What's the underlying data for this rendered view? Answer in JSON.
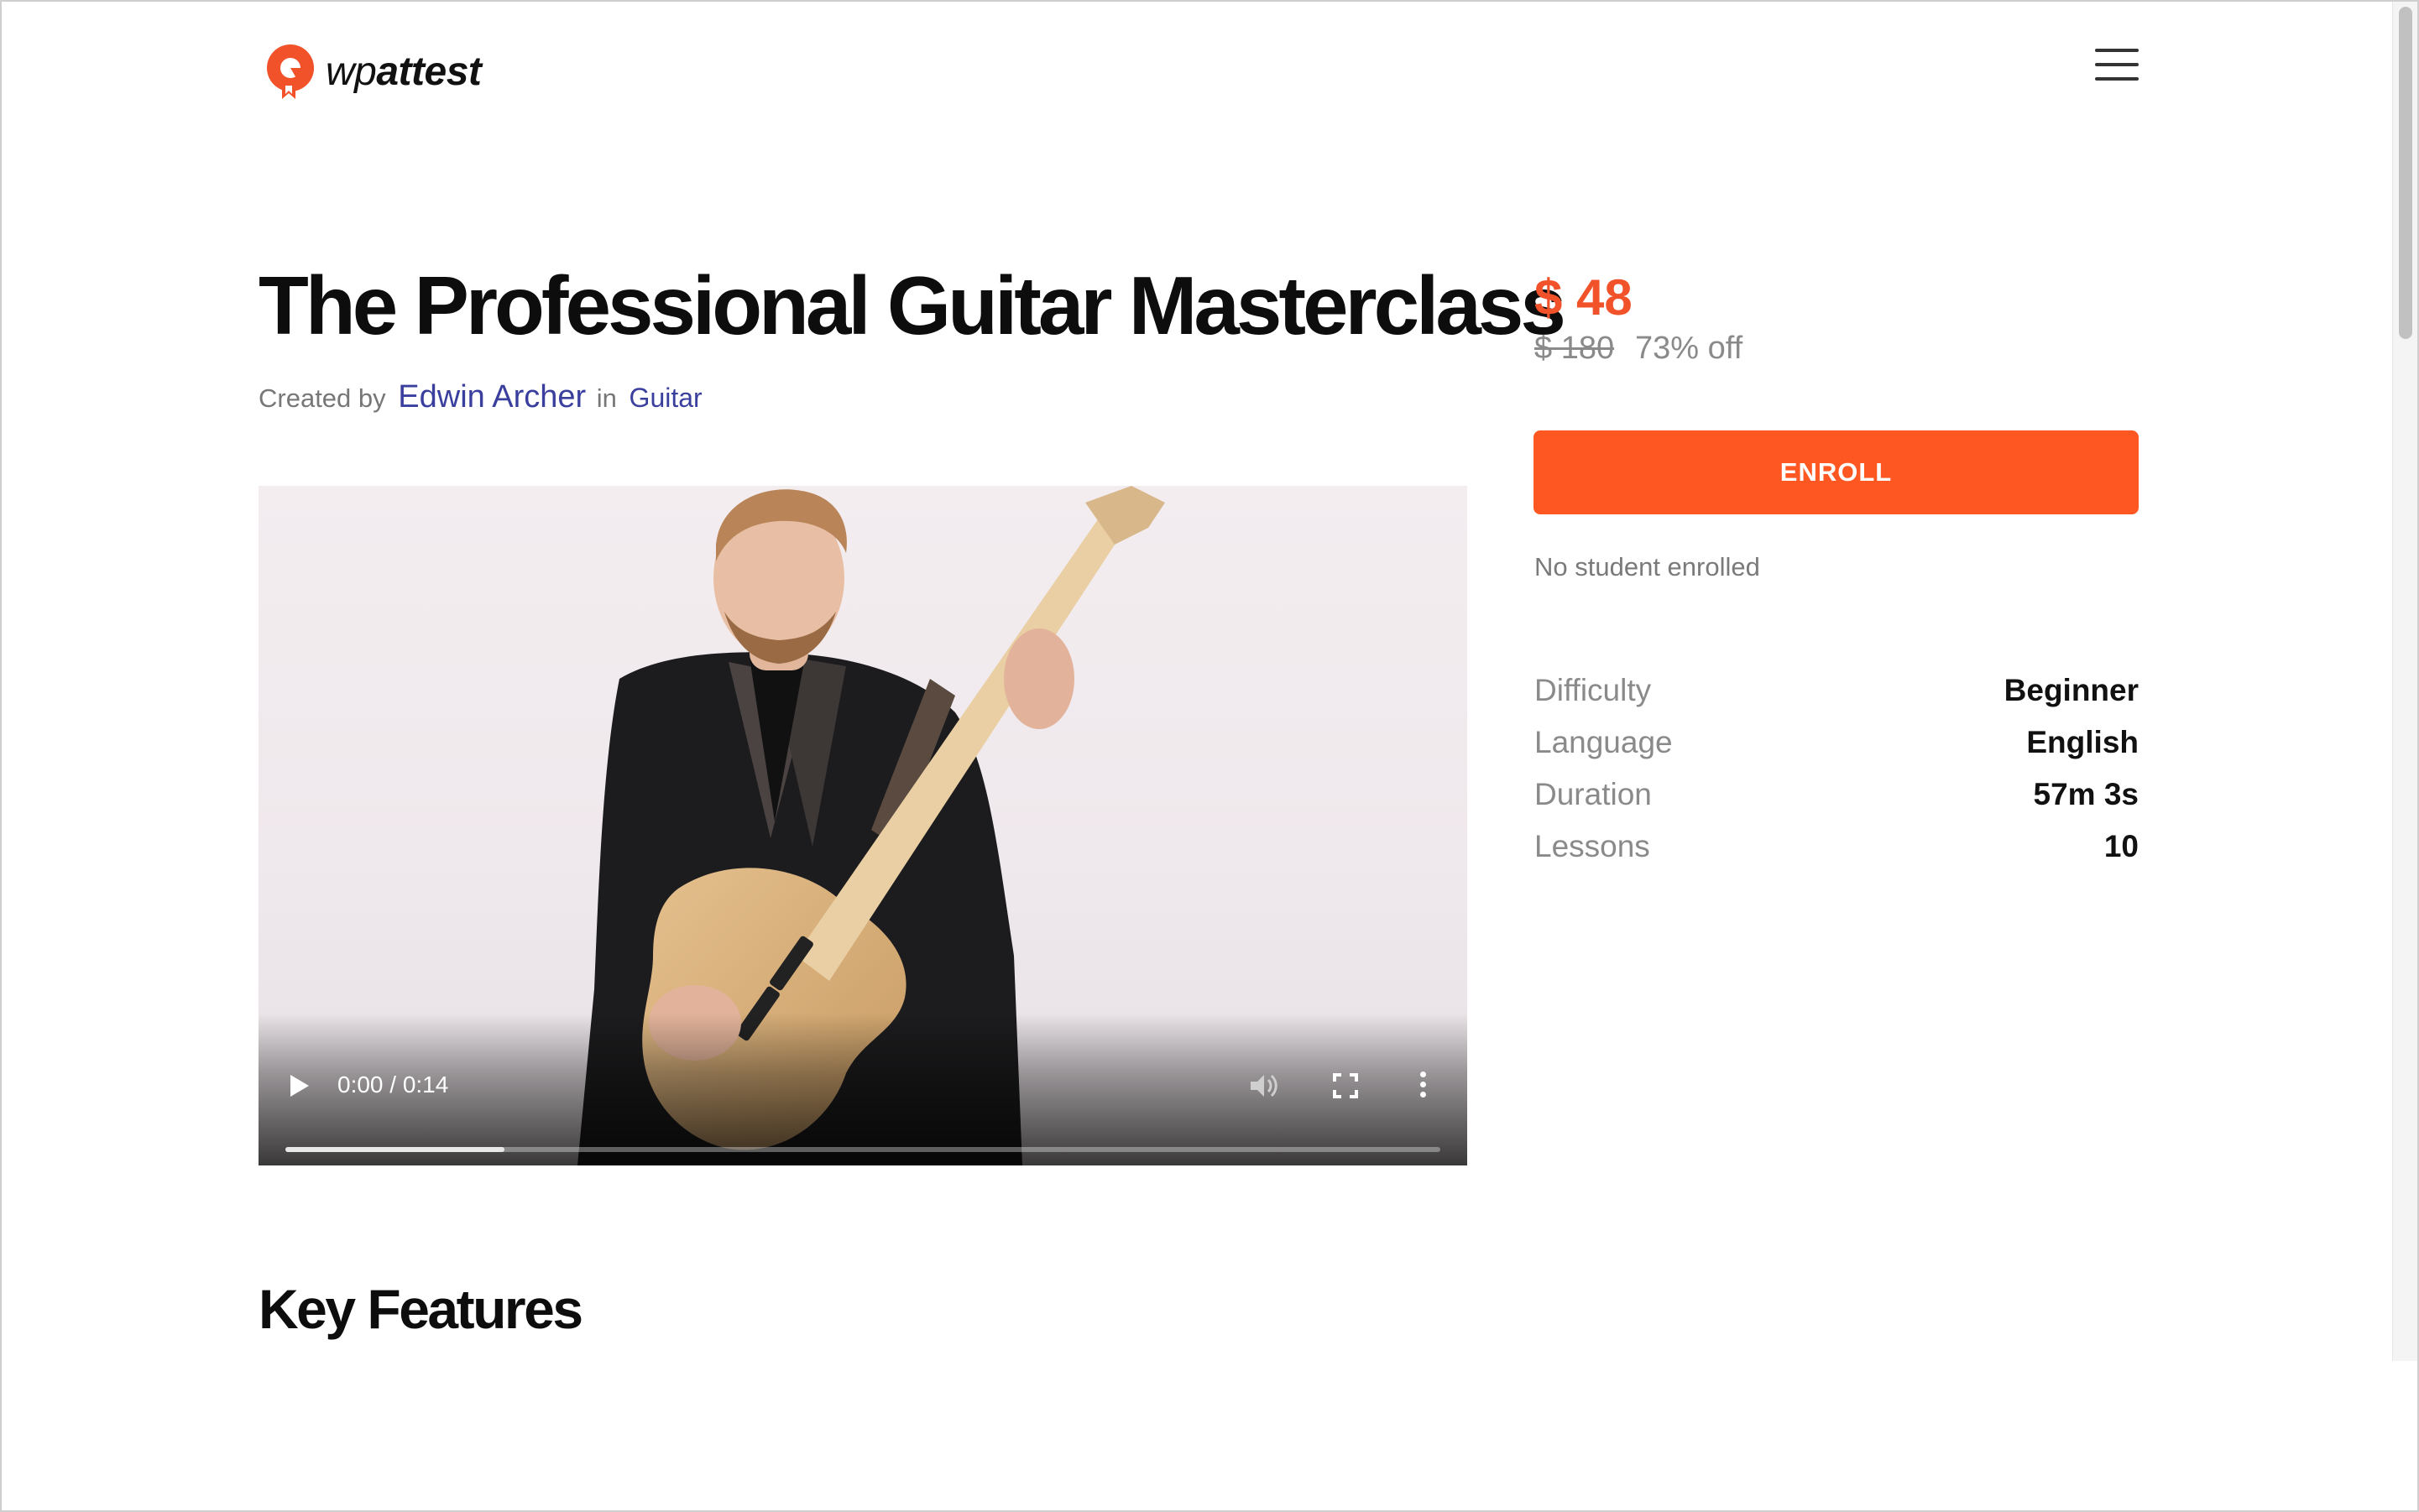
{
  "header": {
    "logo_prefix": "wp",
    "logo_suffix": "attest",
    "brand_color": "#f2522a"
  },
  "course": {
    "title": "The Professional Guitar Masterclass",
    "created_by_label": "Created by",
    "author": "Edwin Archer",
    "in_label": "in",
    "category": "Guitar"
  },
  "video": {
    "time": "0:00 / 0:14",
    "progress": 0.19
  },
  "sections": {
    "key_features": "Key Features"
  },
  "pricing": {
    "price": "$ 48",
    "original_price": "$ 180",
    "discount": "73% off",
    "enroll_label": "ENROLL",
    "enroll_color": "#ff5722",
    "enrolled_note": "No student enrolled"
  },
  "details": [
    {
      "label": "Difficulty",
      "value": "Beginner"
    },
    {
      "label": "Language",
      "value": "English"
    },
    {
      "label": "Duration",
      "value": "57m 3s"
    },
    {
      "label": "Lessons",
      "value": "10"
    }
  ]
}
